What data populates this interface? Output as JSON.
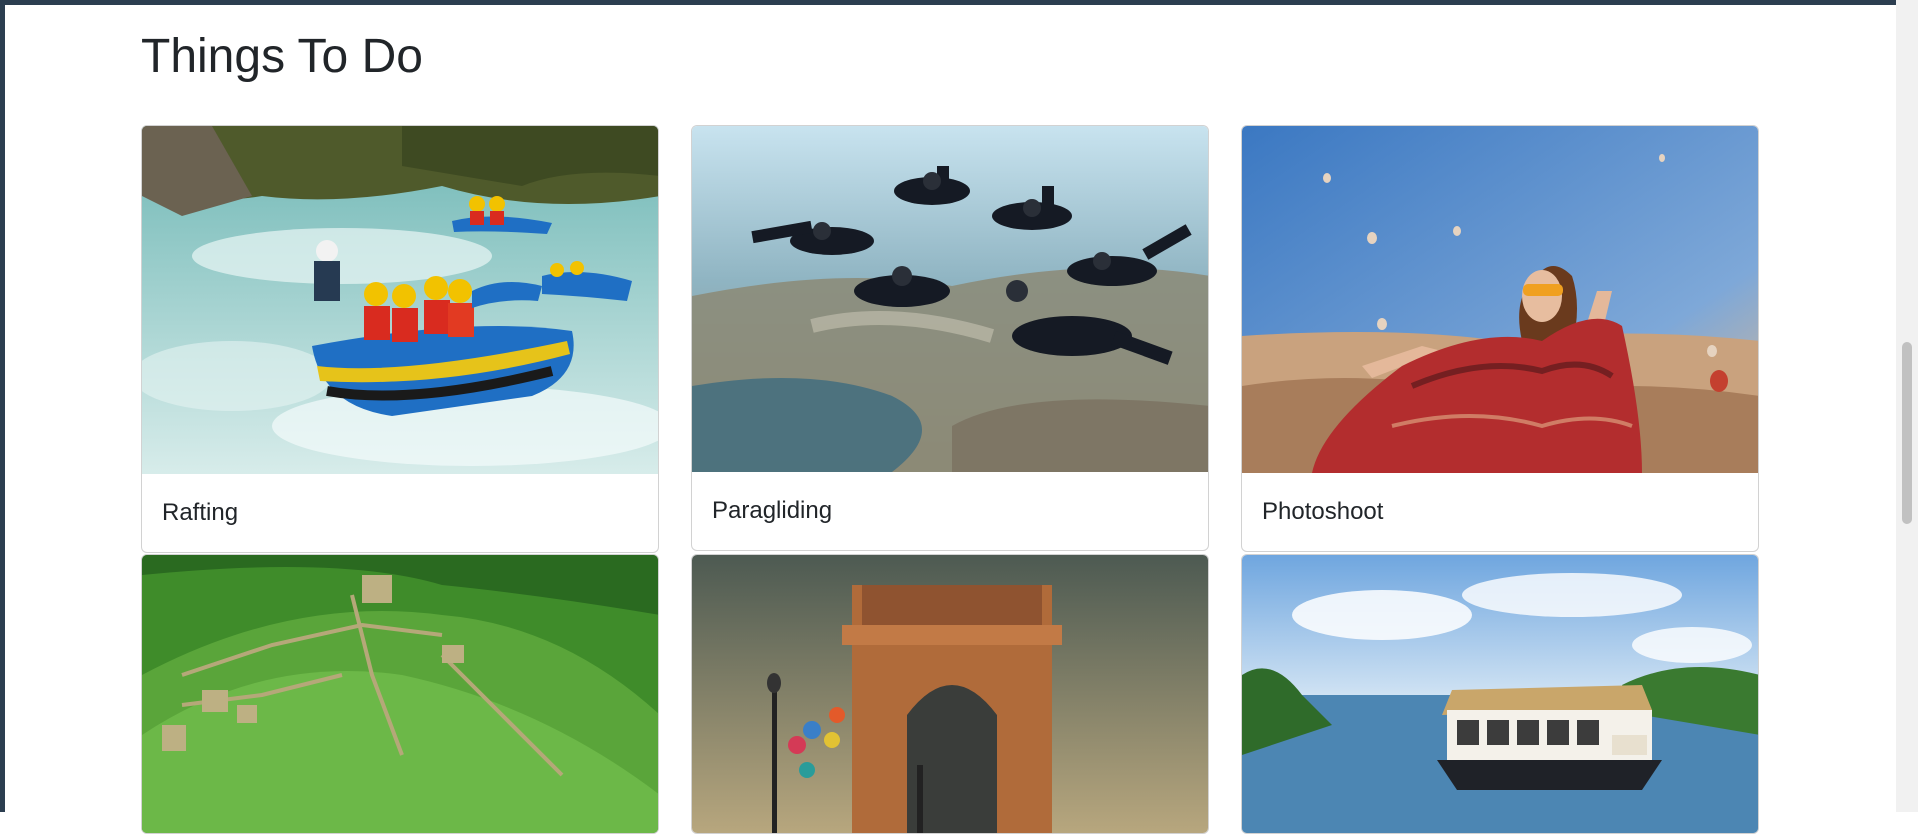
{
  "section": {
    "title": "Things To Do"
  },
  "cards": [
    {
      "title": "Rafting",
      "image": "rafting-photo"
    },
    {
      "title": "Paragliding",
      "image": "skydiving-formation-photo"
    },
    {
      "title": "Photoshoot",
      "image": "woman-with-hot-air-balloons-photo"
    },
    {
      "title": "",
      "image": "hill-fort-aerial-photo"
    },
    {
      "title": "",
      "image": "india-gate-photo"
    },
    {
      "title": "",
      "image": "kerala-houseboat-photo"
    }
  ]
}
